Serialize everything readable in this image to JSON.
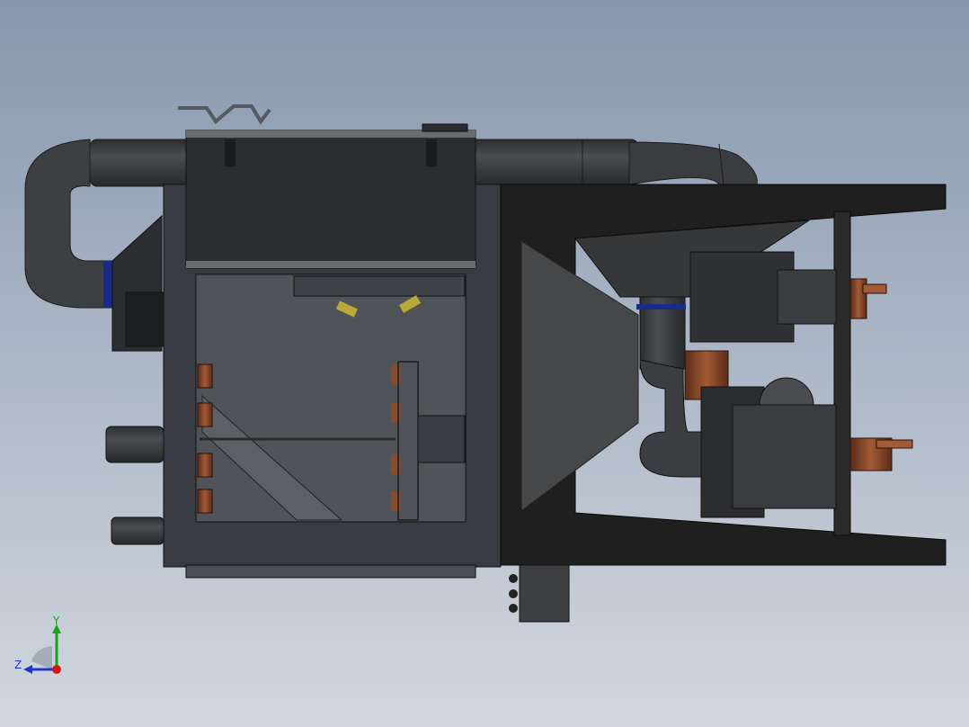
{
  "viewport": {
    "background_top": "#8797ad",
    "background_bottom": "#d2d7de"
  },
  "model": {
    "body_color": "#383c42",
    "panel_color": "#505357",
    "frame_color": "#1f1f1f",
    "pipe_color": "#3b3d40",
    "valve_color": "#8a4a2c",
    "band_color": "#1a2a8a",
    "nozzle_color": "#b9a83a"
  },
  "triad": {
    "x_label": "",
    "y_label": "Y",
    "z_label": "Z",
    "y_color": "#1aa31a",
    "z_color": "#2433c8",
    "x_color": "#d01818"
  }
}
